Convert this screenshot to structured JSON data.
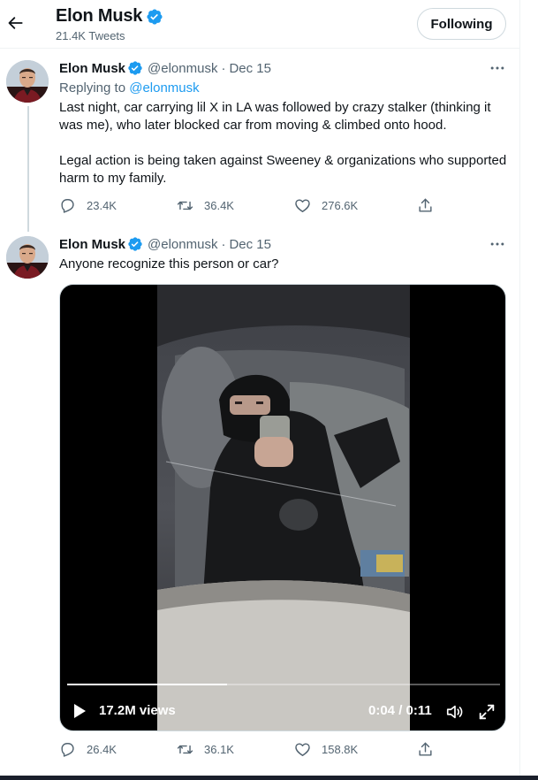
{
  "header": {
    "name": "Elon Musk",
    "tweet_count": "21.4K Tweets",
    "follow_label": "Following"
  },
  "tweets": [
    {
      "name": "Elon Musk",
      "handle": "@elonmusk",
      "dot": "·",
      "date": "Dec 15",
      "replying_prefix": "Replying to",
      "replying_to": "@elonmusk",
      "text": "Last night, car carrying lil X in LA was followed by crazy stalker (thinking it was me), who later blocked car from moving & climbed onto hood.\n\nLegal action is being taken against Sweeney & organizations who supported harm to my family.",
      "replies": "23.4K",
      "retweets": "36.4K",
      "likes": "276.6K"
    },
    {
      "name": "Elon Musk",
      "handle": "@elonmusk",
      "dot": "·",
      "date": "Dec 15",
      "text": "Anyone recognize this person or car?",
      "replies": "26.4K",
      "retweets": "36.1K",
      "likes": "158.8K",
      "video": {
        "views": "17.2M views",
        "current_time": "0:04",
        "separator": " / ",
        "duration": "0:11",
        "progress": 0.37
      }
    }
  ],
  "icons": {
    "back": "arrow-left-icon",
    "verified": "verified-badge-icon",
    "more": "more-dots-icon",
    "reply": "reply-icon",
    "retweet": "retweet-icon",
    "like": "heart-icon",
    "share": "share-icon",
    "play": "play-icon",
    "volume": "volume-icon",
    "fullscreen": "fullscreen-icon"
  },
  "colors": {
    "accent": "#1d9bf0",
    "text": "#0f1419",
    "secondary": "#536471",
    "border": "#cfd9de"
  }
}
